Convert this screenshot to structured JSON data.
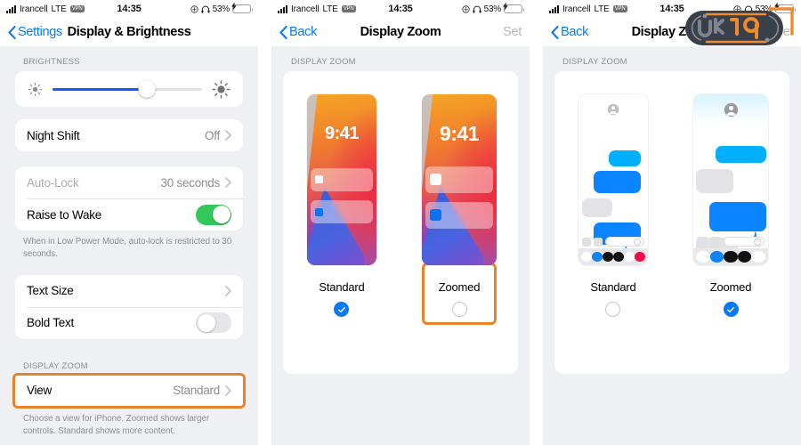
{
  "statusbar": {
    "carrier": "Irancell",
    "network": "LTE",
    "vpn_badge": "VPN",
    "time": "14:35",
    "battery_percent": "53%",
    "icons": [
      "signal-bars-icon",
      "vpn-badge-icon",
      "location-icon",
      "headphones-icon",
      "battery-charging-icon"
    ]
  },
  "panel1": {
    "nav": {
      "back_label": "Settings",
      "title": "Display & Brightness"
    },
    "brightness": {
      "header": "BRIGHTNESS",
      "value_percent": 63,
      "low_icon": "brightness-low-icon",
      "high_icon": "brightness-high-icon"
    },
    "night_shift": {
      "label": "Night Shift",
      "value": "Off"
    },
    "autolock": {
      "label": "Auto-Lock",
      "value": "30 seconds"
    },
    "raise_to_wake": {
      "label": "Raise to Wake",
      "state": "on"
    },
    "autolock_footer": "When in Low Power Mode, auto-lock is restricted to 30 seconds.",
    "text_size": {
      "label": "Text Size"
    },
    "bold_text": {
      "label": "Bold Text",
      "state": "off"
    },
    "display_zoom": {
      "header": "DISPLAY ZOOM",
      "label": "View",
      "value": "Standard",
      "footer": "Choose a view for iPhone. Zoomed shows larger controls. Standard shows more content.",
      "highlighted": true
    }
  },
  "panel2": {
    "nav": {
      "back_label": "Back",
      "title": "Display Zoom",
      "action_label": "Set"
    },
    "section_header": "DISPLAY ZOOM",
    "preview_kind": "lock-screen",
    "lock_time": "9:41",
    "options": [
      {
        "label": "Standard",
        "selected": true,
        "highlighted": false
      },
      {
        "label": "Zoomed",
        "selected": false,
        "highlighted": true
      }
    ]
  },
  "panel3": {
    "nav": {
      "back_label": "Back",
      "title": "Display Zoom",
      "action_label": "Set"
    },
    "section_header": "DISPLAY ZOOM",
    "preview_kind": "messages",
    "options": [
      {
        "label": "Standard",
        "selected": false,
        "highlighted": false
      },
      {
        "label": "Zoomed",
        "selected": true,
        "highlighted": false
      }
    ]
  },
  "colors": {
    "accent_blue": "#047aff",
    "highlight_orange": "#e8832a",
    "toggle_green": "#34c759",
    "slider_blue": "#0a5df5",
    "battery_yellow": "#f7c94b",
    "page_bg": "#eff0f4"
  },
  "watermark": {
    "name": "uk19-logo-watermark"
  }
}
